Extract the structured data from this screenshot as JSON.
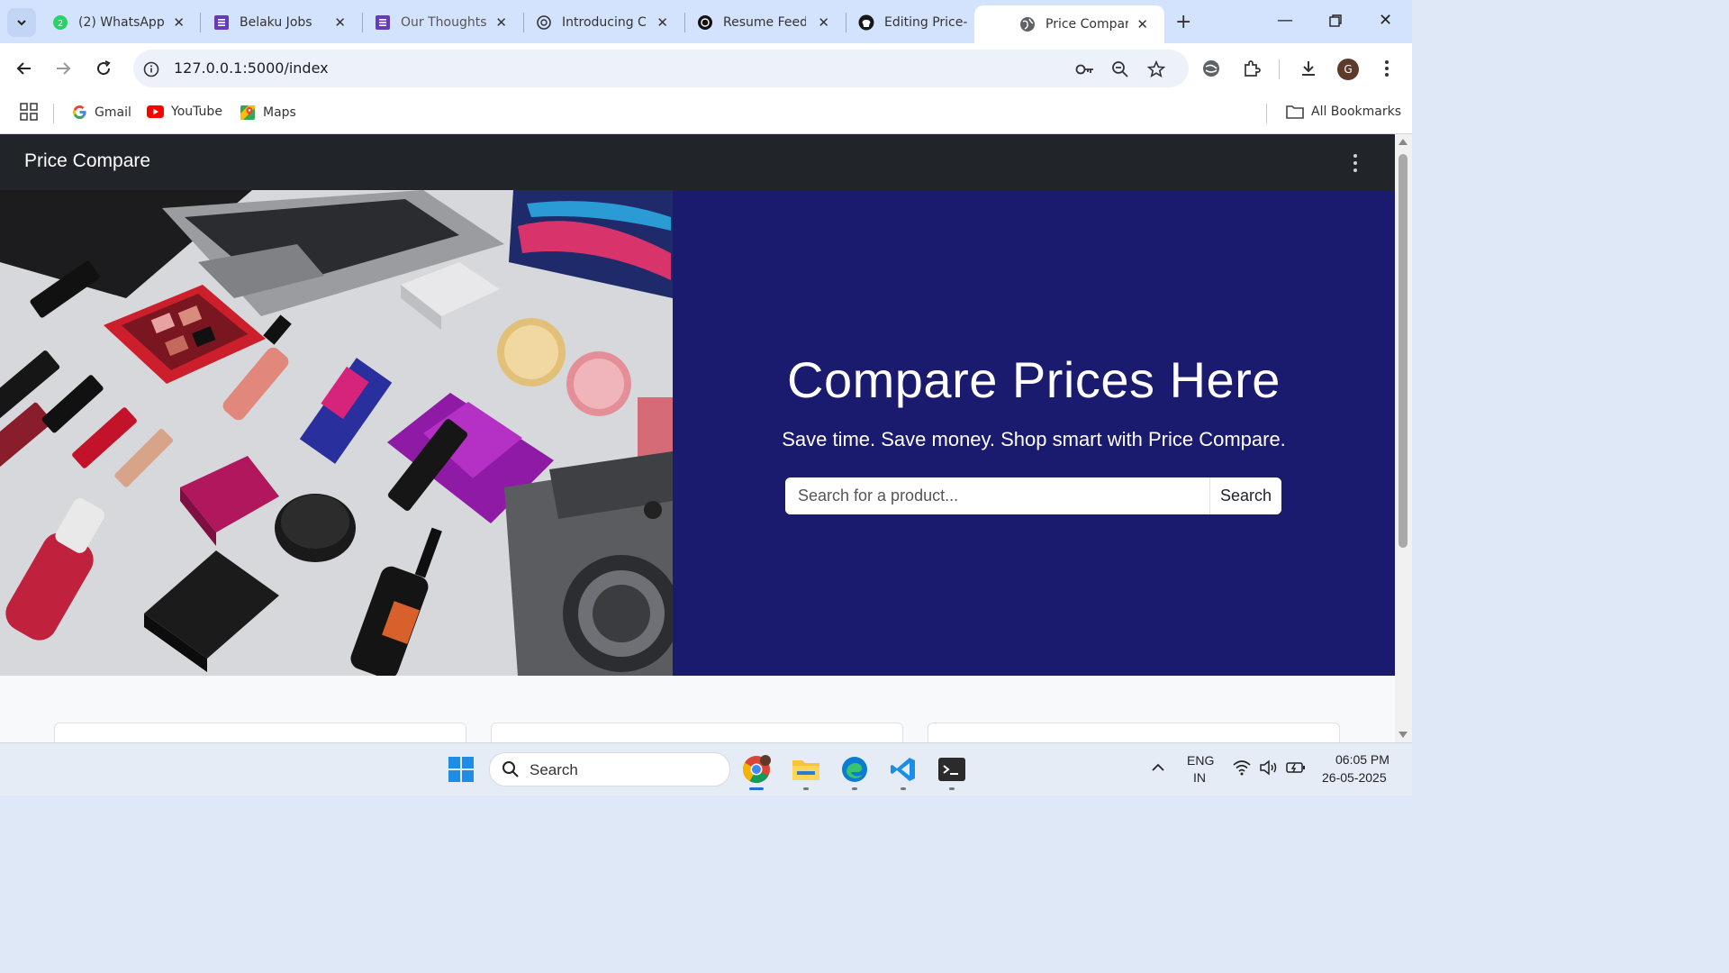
{
  "browser": {
    "tabs": [
      {
        "title": "(2) WhatsApp",
        "icon": "whatsapp-icon"
      },
      {
        "title": "Belaku Jobs",
        "icon": "forms-icon"
      },
      {
        "title": "Our Thoughts",
        "icon": "forms-icon"
      },
      {
        "title": "Introducing Cl",
        "icon": "openai-icon"
      },
      {
        "title": "Resume Feedl",
        "icon": "openai-icon"
      },
      {
        "title": "Editing Price-C",
        "icon": "github-icon"
      },
      {
        "title": "Price Compare",
        "icon": "globe-icon",
        "active": true
      }
    ],
    "url": "127.0.0.1:5000/index",
    "profile_initial": "G",
    "bookmarks": [
      {
        "label": "Gmail",
        "icon": "google-icon"
      },
      {
        "label": "YouTube",
        "icon": "youtube-icon"
      },
      {
        "label": "Maps",
        "icon": "maps-icon"
      }
    ],
    "all_bookmarks_label": "All Bookmarks"
  },
  "page": {
    "brand": "Price Compare",
    "hero": {
      "title": "Compare Prices Here",
      "subtitle": "Save time. Save money. Shop smart with Price Compare.",
      "search_placeholder": "Search for a product...",
      "search_button": "Search",
      "background_color": "#1a1a6e"
    }
  },
  "taskbar": {
    "search_label": "Search",
    "language": "ENG",
    "region": "IN",
    "time": "06:05 PM",
    "date": "26-05-2025"
  }
}
